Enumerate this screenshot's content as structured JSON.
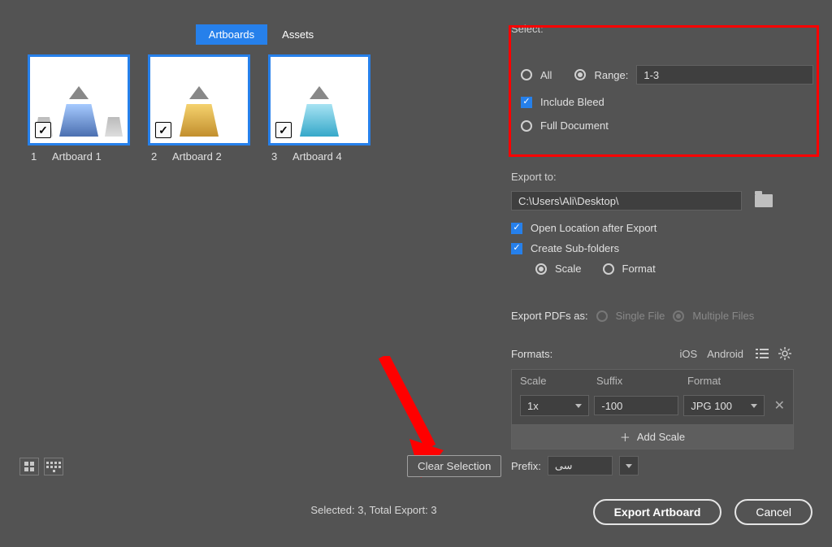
{
  "tabs": {
    "artboards": "Artboards",
    "assets": "Assets",
    "active": "artboards"
  },
  "thumbs": [
    {
      "num": "1",
      "name": "Artboard 1"
    },
    {
      "num": "2",
      "name": "Artboard 2"
    },
    {
      "num": "3",
      "name": "Artboard 4"
    }
  ],
  "select": {
    "heading": "Select:",
    "all": "All",
    "range_label": "Range:",
    "range_value": "1-3",
    "include_bleed": "Include Bleed",
    "full_document": "Full Document"
  },
  "export_to": {
    "label": "Export to:",
    "path": "C:\\Users\\Ali\\Desktop\\",
    "open_location": "Open Location after Export",
    "create_subfolders": "Create Sub-folders",
    "scale": "Scale",
    "format": "Format"
  },
  "export_pdfs": {
    "label": "Export PDFs as:",
    "single": "Single File",
    "multiple": "Multiple Files"
  },
  "formats": {
    "label": "Formats:",
    "ios": "iOS",
    "android": "Android",
    "col_scale": "Scale",
    "col_suffix": "Suffix",
    "col_format": "Format",
    "row": {
      "scale": "1x",
      "suffix": "-100",
      "format": "JPG 100"
    },
    "add_scale": "Add Scale"
  },
  "prefix": {
    "label": "Prefix:",
    "value": "سی"
  },
  "clear_selection": "Clear Selection",
  "status": "Selected: 3, Total Export: 3",
  "buttons": {
    "export": "Export Artboard",
    "cancel": "Cancel"
  }
}
